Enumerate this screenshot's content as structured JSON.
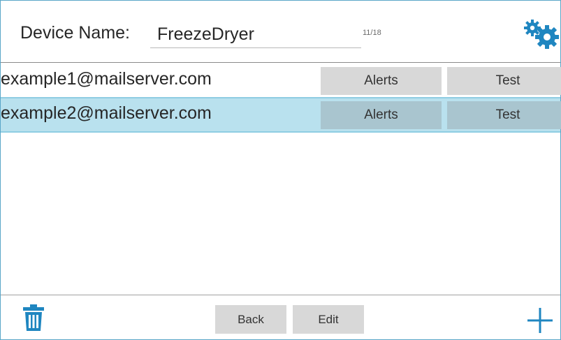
{
  "header": {
    "device_label": "Device Name:",
    "device_name_value": "FreezeDryer",
    "char_counter": "11/18",
    "settings_icon": "gears-icon"
  },
  "emails": [
    {
      "address": "example1@mailserver.com",
      "alerts_label": "Alerts",
      "test_label": "Test",
      "selected": false
    },
    {
      "address": "example2@mailserver.com",
      "alerts_label": "Alerts",
      "test_label": "Test",
      "selected": true
    }
  ],
  "footer": {
    "delete_icon": "trash-icon",
    "back_label": "Back",
    "edit_label": "Edit",
    "add_icon": "plus-icon"
  },
  "colors": {
    "accent": "#1f86c0",
    "selected_row": "#b9e1ee",
    "button_bg": "#d8d8d8"
  }
}
